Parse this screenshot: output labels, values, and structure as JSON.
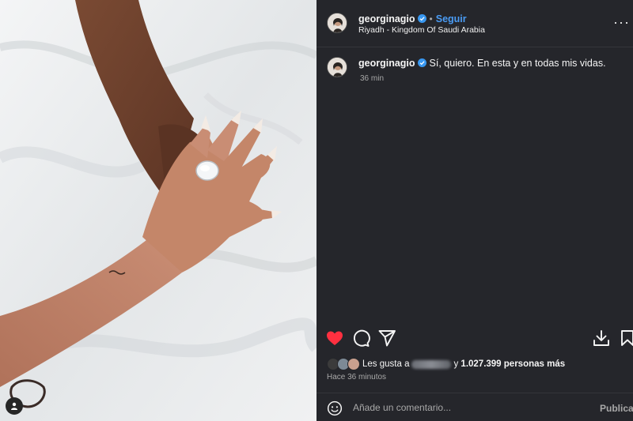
{
  "post": {
    "username": "georginagio",
    "follow_label": "Seguir",
    "dot": "•",
    "location": "Riyadh - Kingdom Of Saudi Arabia",
    "more": "···"
  },
  "caption": {
    "username": "georginagio",
    "text": "Sí, quiero. En esta y en todas mis vidas.",
    "time": "36 min"
  },
  "likes": {
    "prefix": "Les gusta a",
    "middle": "y",
    "count_text": "1.027.399 personas más",
    "time_ago": "Hace 36 minutos"
  },
  "comment": {
    "placeholder": "Añade un comentario...",
    "publish_label": "Publicar"
  },
  "colors": {
    "panel_bg": "#25262b",
    "like_red": "#ff3040",
    "verified_blue": "#3897f0",
    "follow_blue": "#4a9cf5"
  },
  "icons": [
    "verified-icon",
    "more-options-icon",
    "heart-icon",
    "comment-icon",
    "share-icon",
    "download-icon",
    "save-icon",
    "emoji-icon",
    "user-tag-icon"
  ]
}
